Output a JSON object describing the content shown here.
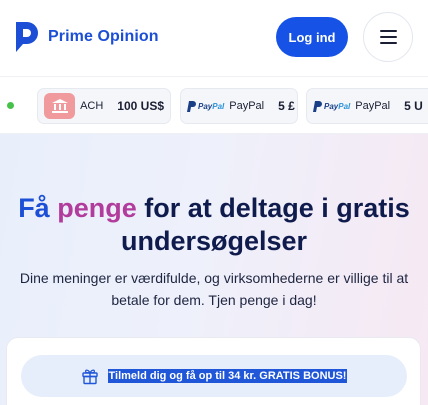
{
  "header": {
    "brand": "Prime Opinion",
    "login_label": "Log ind"
  },
  "ticker": {
    "items": [
      {
        "method": "ACH",
        "amount": "100 US$",
        "icon": "bank-icon"
      },
      {
        "method": "PayPal",
        "amount": "5 £",
        "icon": "paypal-logo"
      },
      {
        "method": "PayPal",
        "amount": "5 U",
        "icon": "paypal-logo"
      }
    ],
    "paypal_wordmark_pay": "Pay",
    "paypal_wordmark_pal": "Pal"
  },
  "hero": {
    "title_part1": "Få",
    "title_part2": "penge",
    "title_part3": "for at deltage i gratis undersøgelser",
    "subtitle": "Dine meninger er værdifulde, og virksomhederne er villige til at betale for dem. Tjen penge i dag!"
  },
  "signup": {
    "bonus_text": "Tilmeld dig og få op til 34 kr. GRATIS BONUS!"
  },
  "colors": {
    "brand_blue": "#1c4fd6",
    "button_blue": "#1652e6",
    "accent_pink": "#b13c9c",
    "live_green": "#46c24a",
    "bank_pink": "#f19a9d"
  }
}
